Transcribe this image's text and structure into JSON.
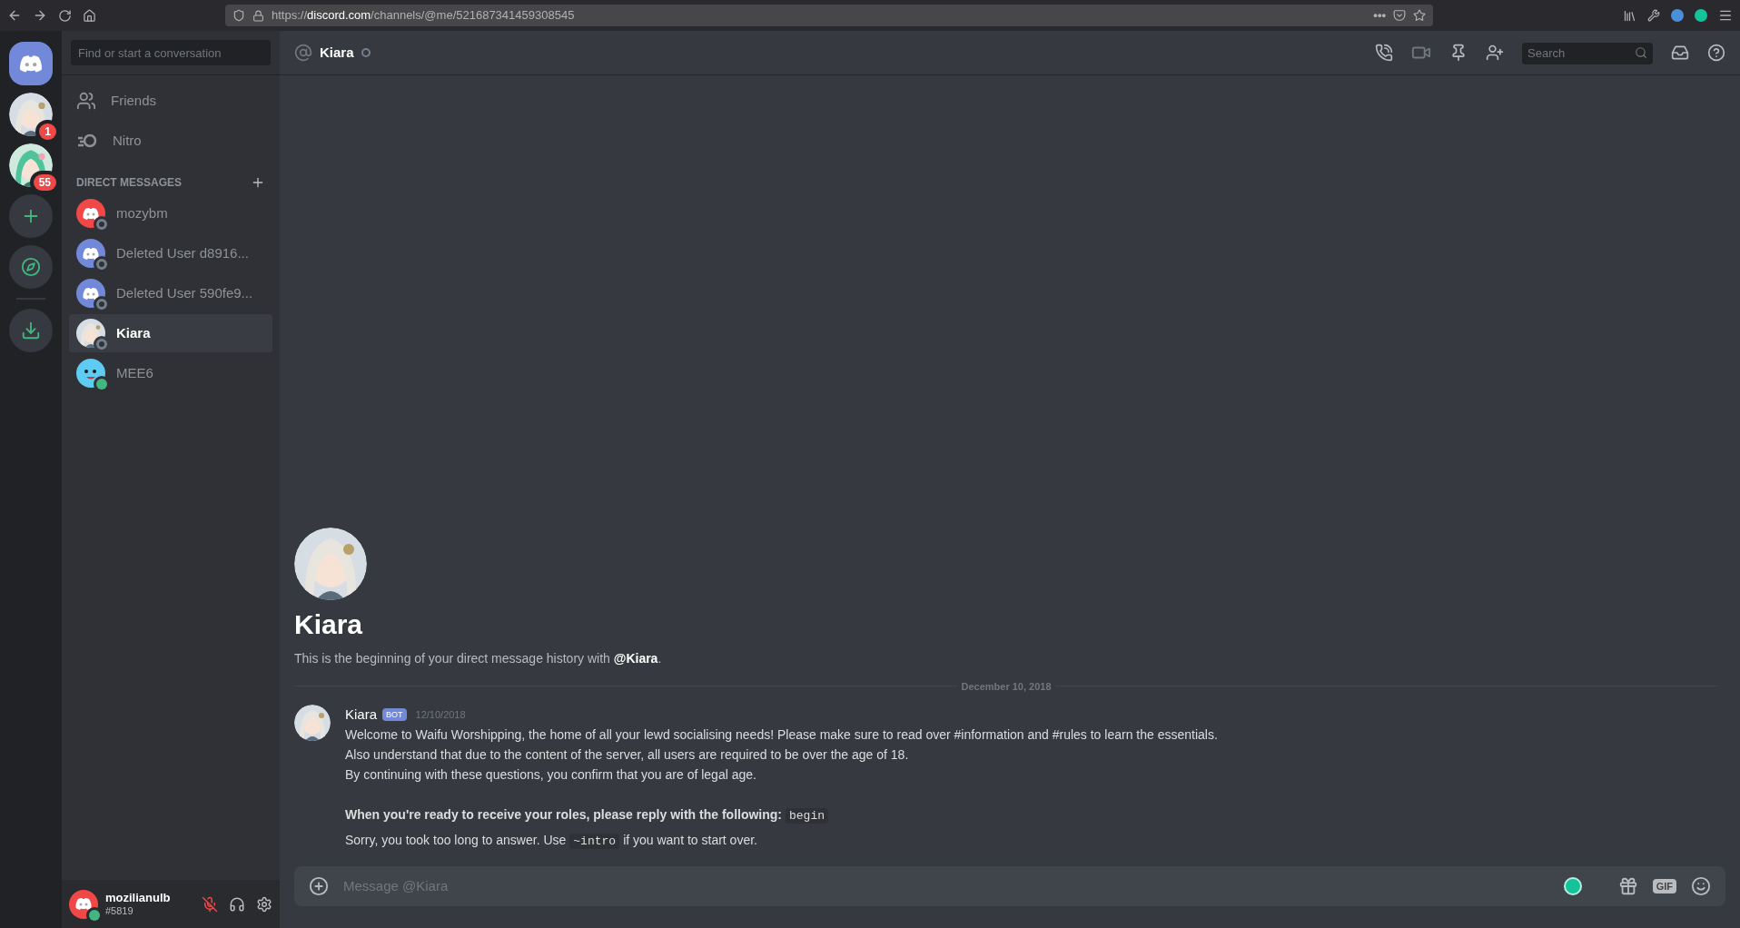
{
  "browser": {
    "url": "https://**discord.com**/channels/@me/521687341459308545",
    "menu_dots": "•••"
  },
  "servers": [
    {
      "kind": "home",
      "selected": true
    },
    {
      "kind": "picture",
      "badge": "1"
    },
    {
      "kind": "picture",
      "badge": "55"
    },
    {
      "kind": "add"
    },
    {
      "kind": "explore"
    },
    {
      "kind": "separator"
    },
    {
      "kind": "download"
    }
  ],
  "dm_search": {
    "placeholder": "Find or start a conversation"
  },
  "nav": [
    {
      "kind": "friends",
      "label": "Friends"
    },
    {
      "kind": "nitro",
      "label": "Nitro"
    }
  ],
  "dm_header": "DIRECT MESSAGES",
  "dms": [
    {
      "name": "mozybm",
      "kind": "logo",
      "color": "#f04747",
      "online": false,
      "selected": false
    },
    {
      "name": "Deleted User d8916...",
      "kind": "logo",
      "color": "#7289da",
      "online": false,
      "selected": false
    },
    {
      "name": "Deleted User 590fe9...",
      "kind": "logo",
      "color": "#7289da",
      "online": false,
      "selected": false
    },
    {
      "name": "Kiara",
      "kind": "picture",
      "online": false,
      "selected": true
    },
    {
      "name": "MEE6",
      "kind": "face",
      "color": "#5ecbf2",
      "online": true,
      "selected": false
    }
  ],
  "user": {
    "name": "mozilianulb",
    "tag": "#5819",
    "online": true,
    "mic_muted": true
  },
  "channel": {
    "name": "Kiara",
    "online": false
  },
  "header_search": {
    "placeholder": "Search"
  },
  "intro": {
    "title": "Kiara",
    "text": "This is the beginning of your direct message history with **@Kiara**."
  },
  "divider_date": "December 10, 2018",
  "message": {
    "author": "Kiara",
    "badge": "BOT",
    "time": "12/10/2018",
    "lines": [
      {
        "kind": "text",
        "parts": [
          {
            "kind": "plain",
            "text": "Welcome to Waifu Worshipping, the home of all your lewd socialising needs! Please make sure to read over #information and #rules to learn the essentials."
          }
        ]
      },
      {
        "kind": "text",
        "parts": [
          {
            "kind": "plain",
            "text": "Also understand that due to the content of the server, all users are required to be over the age of 18."
          }
        ]
      },
      {
        "kind": "text",
        "parts": [
          {
            "kind": "plain",
            "text": "By continuing with these questions, you confirm that you are of legal age."
          }
        ]
      },
      {
        "kind": "blank"
      },
      {
        "kind": "text",
        "parts": [
          {
            "kind": "bold",
            "text": "When you're ready to receive your roles, please reply with the following:"
          },
          {
            "kind": "code",
            "text": "begin"
          }
        ]
      }
    ]
  },
  "followup": [
    {
      "kind": "plain",
      "text": "Sorry, you took too long to answer. Use"
    },
    {
      "kind": "code",
      "text": "~intro"
    },
    {
      "kind": "plain",
      "text": "if you want to start over."
    }
  ],
  "composer": {
    "placeholder": "Message @Kiara",
    "gif_label": "GIF"
  }
}
